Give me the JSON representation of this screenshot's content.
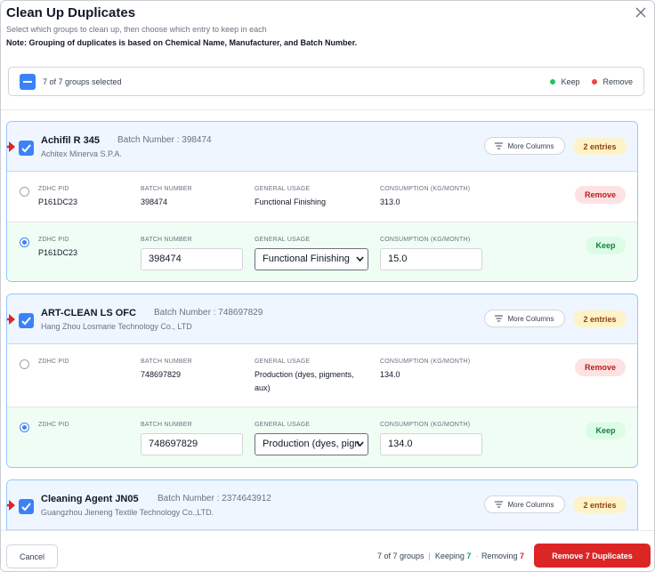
{
  "modal": {
    "title": "Clean Up Duplicates",
    "subtitle": "Select which groups to clean up, then choose which entry to keep in each",
    "note": "Note: Grouping of duplicates is based on Chemical Name, Manufacturer, and Batch Number."
  },
  "summary": {
    "selected_text": "7 of 7 groups selected",
    "legend_keep": "Keep",
    "legend_remove": "Remove"
  },
  "colors": {
    "accent": "#3b82f6",
    "keep": "#22c55e",
    "remove": "#ef4444",
    "danger_button": "#dc2626"
  },
  "columns": {
    "zdhc": "ZDHC PID",
    "batch": "BATCH NUMBER",
    "usage": "GENERAL USAGE",
    "consumption": "CONSUMPTION (KG/MONTH)"
  },
  "groups": [
    {
      "name": "Achifil R 345",
      "batch_label": "Batch Number :  398474",
      "manufacturer": "Achitex Minerva S.P.A.",
      "more_columns": "More Columns",
      "entries": "2 entries",
      "remove_row": {
        "zdhc": "P161DC23",
        "batch": "398474",
        "usage": "Functional Finishing",
        "consumption": "313.0",
        "status": "Remove"
      },
      "keep_row": {
        "zdhc": "P161DC23",
        "batch": "398474",
        "usage": "Functional Finishing",
        "consumption": "15.0",
        "status": "Keep"
      }
    },
    {
      "name": "ART-CLEAN LS OFC",
      "batch_label": "Batch Number :  748697829",
      "manufacturer": "Hang Zhou Losmarie Technology Co., LTD",
      "more_columns": "More Columns",
      "entries": "2 entries",
      "remove_row": {
        "zdhc": "",
        "batch": "748697829",
        "usage": "Production (dyes, pigments, aux)",
        "consumption": "134.0",
        "status": "Remove"
      },
      "keep_row": {
        "zdhc": "",
        "batch": "748697829",
        "usage": "Production (dyes, pigments, aux)",
        "consumption": "134.0",
        "status": "Keep"
      }
    },
    {
      "name": "Cleaning Agent JN05",
      "batch_label": "Batch Number :  2374643912",
      "manufacturer": "Guangzhou Jieneng Textile Technology Co.,LTD.",
      "more_columns": "More Columns",
      "entries": "2 entries"
    }
  ],
  "footer": {
    "cancel": "Cancel",
    "groups_text": "7 of 7 groups",
    "keeping_label": "Keeping",
    "keeping_count": "7",
    "removing_label": "Removing",
    "removing_count": "7",
    "remove_button": "Remove 7 Duplicates"
  }
}
